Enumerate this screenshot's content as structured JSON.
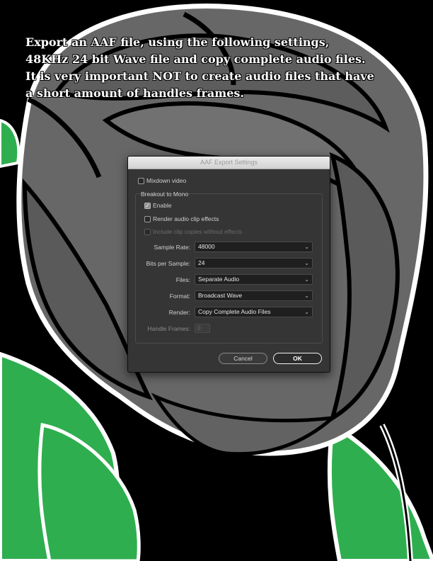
{
  "instructions": {
    "line1": "Export an AAF file, using the following settings,",
    "line2": "48KHz 24 bit Wave file and copy complete audio files.",
    "line3": "It is very important NOT to create audio files that have",
    "line4": "a short amount of handles frames."
  },
  "dialog": {
    "title": "AAF Export Settings",
    "mixdown_video": {
      "label": "Mixdown video",
      "checked": false
    },
    "breakout_group_label": "Breakout to Mono",
    "enable": {
      "label": "Enable",
      "checked": true
    },
    "render_effects": {
      "label": "Render audio clip effects",
      "checked": false
    },
    "include_copies": {
      "label": "Include clip copies without effects",
      "checked": false,
      "disabled": true
    },
    "sample_rate": {
      "label": "Sample Rate:",
      "value": "48000"
    },
    "bits_per_sample": {
      "label": "Bits per Sample:",
      "value": "24"
    },
    "files": {
      "label": "Files:",
      "value": "Separate Audio"
    },
    "format": {
      "label": "Format:",
      "value": "Broadcast Wave"
    },
    "render": {
      "label": "Render:",
      "value": "Copy Complete Audio Files"
    },
    "handle_frames": {
      "label": "Handle Frames:",
      "value": "0"
    },
    "cancel_label": "Cancel",
    "ok_label": "OK"
  },
  "colors": {
    "leaf_green": "#2fae4f",
    "rose_gray": "#676767",
    "outline": "#ffffff",
    "background": "#000000",
    "dialog_bg": "#353535"
  }
}
